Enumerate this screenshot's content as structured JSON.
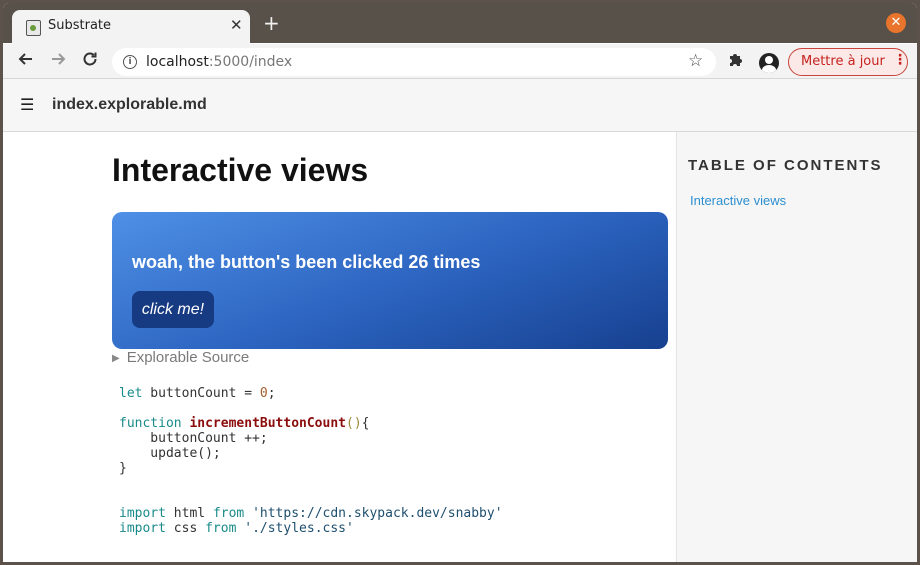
{
  "browser": {
    "tab_title": "Substrate",
    "tab_close": "✕",
    "new_tab": "+",
    "window_close": "✕",
    "url_host": "localhost",
    "url_rest": ":5000/index",
    "update_label": "Mettre à jour",
    "update_menu": "⋮"
  },
  "app": {
    "menu_glyph": "☰",
    "title": "index.explorable.md"
  },
  "main": {
    "heading": "Interactive views",
    "demo": {
      "text": "woah, the button's been clicked 26 times",
      "button_label": "click me!"
    },
    "details_summary": "Explorable Source",
    "code": {
      "line1": {
        "kw": "let",
        "rest": " buttonCount = ",
        "num": "0",
        "end": ";"
      },
      "line3": {
        "kw": "function",
        "sp": " ",
        "fn": "incrementButtonCount",
        "paren": "()",
        "end": "{"
      },
      "line4": "    buttonCount ++;",
      "line5": "    update();",
      "line6": "}",
      "line9": {
        "kw1": "import",
        "mid": " html ",
        "kw2": "from",
        "sp": " ",
        "str": "'https://cdn.skypack.dev/snabby'"
      },
      "line10": {
        "kw1": "import",
        "mid": " css ",
        "kw2": "from",
        "sp": " ",
        "str": "'./styles.css'"
      }
    }
  },
  "toc": {
    "heading": "TABLE OF CONTENTS",
    "items": [
      {
        "label": "Interactive views"
      }
    ]
  },
  "colors": {
    "accent_link": "#2d8fd0",
    "card_gradient_start": "#4f90e6",
    "card_gradient_end": "#17408f",
    "update_button": "#c5221f",
    "window_close": "#e9742b"
  },
  "icons": [
    "page-favicon-icon",
    "close-icon",
    "plus-icon",
    "back-arrow-icon",
    "forward-arrow-icon",
    "reload-icon",
    "info-icon",
    "star-icon",
    "puzzle-extension-icon",
    "profile-icon",
    "kebab-menu-icon",
    "hamburger-menu-icon",
    "disclosure-triangle-icon"
  ]
}
